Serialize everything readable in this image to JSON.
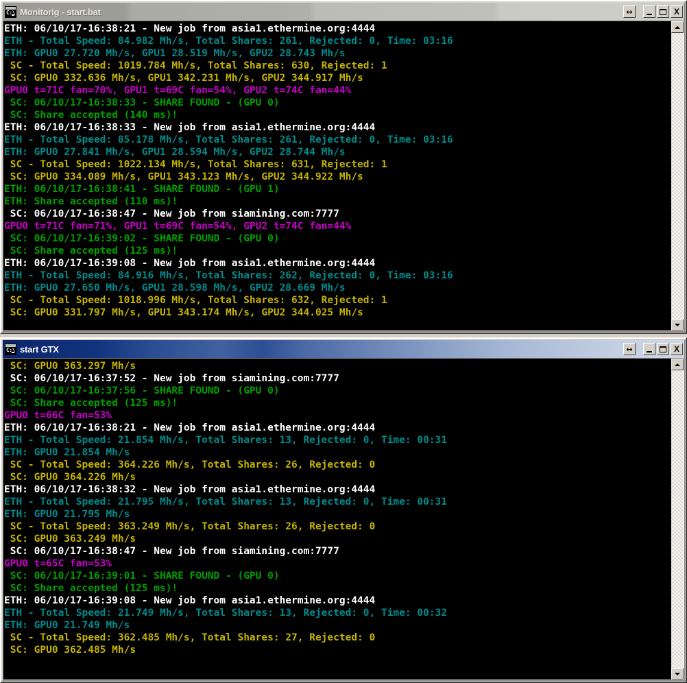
{
  "desktop": {
    "background_color": "#d4d0c8"
  },
  "palette": {
    "console_background": "#000000",
    "white": "#c0c0c0",
    "bright_white": "#ffffff",
    "cyan": "#008b8b",
    "yellow": "#c5b300",
    "magenta": "#c800c8",
    "green": "#00a000",
    "titlebar_active_start": "#0a246a",
    "titlebar_active_end": "#cfd8e8",
    "titlebar_inactive_start": "#9b9b95",
    "titlebar_inactive_end": "#cfcfc9",
    "chrome_face": "#d4d0c8"
  },
  "windows": [
    {
      "id": "monitorig",
      "title": "Monitorig - start.bat",
      "active": false,
      "icon": "cmd-console-icon",
      "buttons": {
        "resize": "↔",
        "minimize": "_",
        "maximize": "□",
        "close": "X"
      },
      "scrollbar": {
        "up_arrow": "▲",
        "down_arrow": "▼",
        "position": "bottom"
      },
      "lines": [
        {
          "color": "bwhite",
          "text": "ETH: 06/10/17-16:38:21 - New job from asia1.ethermine.org:4444"
        },
        {
          "color": "cyan",
          "text": "ETH - Total Speed: 84.982 Mh/s, Total Shares: 261, Rejected: 0, Time: 03:16"
        },
        {
          "color": "cyan",
          "text": "ETH: GPU0 27.720 Mh/s, GPU1 28.519 Mh/s, GPU2 28.743 Mh/s"
        },
        {
          "color": "yellow",
          "text": " SC - Total Speed: 1019.784 Mh/s, Total Shares: 630, Rejected: 1"
        },
        {
          "color": "yellow",
          "text": " SC: GPU0 332.636 Mh/s, GPU1 342.231 Mh/s, GPU2 344.917 Mh/s"
        },
        {
          "color": "magenta",
          "text": "GPU0 t=71C fan=70%, GPU1 t=69C fan=54%, GPU2 t=74C fan=44%"
        },
        {
          "color": "green",
          "text": " SC: 06/10/17-16:38:33 - SHARE FOUND - (GPU 0)"
        },
        {
          "color": "green",
          "text": " SC: Share accepted (140 ms)!"
        },
        {
          "color": "bwhite",
          "text": "ETH: 06/10/17-16:38:33 - New job from asia1.ethermine.org:4444"
        },
        {
          "color": "cyan",
          "text": "ETH - Total Speed: 85.178 Mh/s, Total Shares: 261, Rejected: 0, Time: 03:16"
        },
        {
          "color": "cyan",
          "text": "ETH: GPU0 27.841 Mh/s, GPU1 28.594 Mh/s, GPU2 28.744 Mh/s"
        },
        {
          "color": "yellow",
          "text": " SC - Total Speed: 1022.134 Mh/s, Total Shares: 631, Rejected: 1"
        },
        {
          "color": "yellow",
          "text": " SC: GPU0 334.089 Mh/s, GPU1 343.123 Mh/s, GPU2 344.922 Mh/s"
        },
        {
          "color": "green",
          "text": "ETH: 06/10/17-16:38:41 - SHARE FOUND - (GPU 1)"
        },
        {
          "color": "green",
          "text": "ETH: Share accepted (110 ms)!"
        },
        {
          "color": "bwhite",
          "text": " SC: 06/10/17-16:38:47 - New job from siamining.com:7777"
        },
        {
          "color": "magenta",
          "text": "GPU0 t=71C fan=71%, GPU1 t=69C fan=54%, GPU2 t=74C fan=44%"
        },
        {
          "color": "green",
          "text": " SC: 06/10/17-16:39:02 - SHARE FOUND - (GPU 0)"
        },
        {
          "color": "green",
          "text": " SC: Share accepted (125 ms)!"
        },
        {
          "color": "bwhite",
          "text": "ETH: 06/10/17-16:39:08 - New job from asia1.ethermine.org:4444"
        },
        {
          "color": "cyan",
          "text": "ETH - Total Speed: 84.916 Mh/s, Total Shares: 262, Rejected: 0, Time: 03:16"
        },
        {
          "color": "cyan",
          "text": "ETH: GPU0 27.650 Mh/s, GPU1 28.598 Mh/s, GPU2 28.669 Mh/s"
        },
        {
          "color": "yellow",
          "text": " SC - Total Speed: 1018.996 Mh/s, Total Shares: 632, Rejected: 1"
        },
        {
          "color": "yellow",
          "text": " SC: GPU0 331.797 Mh/s, GPU1 343.174 Mh/s, GPU2 344.025 Mh/s"
        }
      ]
    },
    {
      "id": "startgtx",
      "title": "start GTX",
      "active": true,
      "icon": "cmd-console-icon",
      "buttons": {
        "resize": "↔",
        "minimize": "_",
        "maximize": "□",
        "close": "X"
      },
      "scrollbar": {
        "up_arrow": "▲",
        "down_arrow": "▼",
        "position": "bottom"
      },
      "lines": [
        {
          "color": "yellow",
          "text": " SC: GPU0 363.297 Mh/s"
        },
        {
          "color": "bwhite",
          "text": " SC: 06/10/17-16:37:52 - New job from siamining.com:7777"
        },
        {
          "color": "green",
          "text": " SC: 06/10/17-16:37:56 - SHARE FOUND - (GPU 0)"
        },
        {
          "color": "green",
          "text": " SC: Share accepted (125 ms)!"
        },
        {
          "color": "magenta",
          "text": "GPU0 t=66C fan=53%"
        },
        {
          "color": "bwhite",
          "text": "ETH: 06/10/17-16:38:21 - New job from asia1.ethermine.org:4444"
        },
        {
          "color": "cyan",
          "text": "ETH - Total Speed: 21.854 Mh/s, Total Shares: 13, Rejected: 0, Time: 00:31"
        },
        {
          "color": "cyan",
          "text": "ETH: GPU0 21.854 Mh/s"
        },
        {
          "color": "yellow",
          "text": " SC - Total Speed: 364.226 Mh/s, Total Shares: 26, Rejected: 0"
        },
        {
          "color": "yellow",
          "text": " SC: GPU0 364.226 Mh/s"
        },
        {
          "color": "bwhite",
          "text": "ETH: 06/10/17-16:38:32 - New job from asia1.ethermine.org:4444"
        },
        {
          "color": "cyan",
          "text": "ETH - Total Speed: 21.795 Mh/s, Total Shares: 13, Rejected: 0, Time: 00:31"
        },
        {
          "color": "cyan",
          "text": "ETH: GPU0 21.795 Mh/s"
        },
        {
          "color": "yellow",
          "text": " SC - Total Speed: 363.249 Mh/s, Total Shares: 26, Rejected: 0"
        },
        {
          "color": "yellow",
          "text": " SC: GPU0 363.249 Mh/s"
        },
        {
          "color": "bwhite",
          "text": " SC: 06/10/17-16:38:47 - New job from siamining.com:7777"
        },
        {
          "color": "magenta",
          "text": "GPU0 t=65C fan=53%"
        },
        {
          "color": "green",
          "text": " SC: 06/10/17-16:39:01 - SHARE FOUND - (GPU 0)"
        },
        {
          "color": "green",
          "text": " SC: Share accepted (125 ms)!"
        },
        {
          "color": "bwhite",
          "text": "ETH: 06/10/17-16:39:08 - New job from asia1.ethermine.org:4444"
        },
        {
          "color": "cyan",
          "text": "ETH - Total Speed: 21.749 Mh/s, Total Shares: 13, Rejected: 0, Time: 00:32"
        },
        {
          "color": "cyan",
          "text": "ETH: GPU0 21.749 Mh/s"
        },
        {
          "color": "yellow",
          "text": " SC - Total Speed: 362.485 Mh/s, Total Shares: 27, Rejected: 0"
        },
        {
          "color": "yellow",
          "text": " SC: GPU0 362.485 Mh/s"
        }
      ]
    }
  ]
}
